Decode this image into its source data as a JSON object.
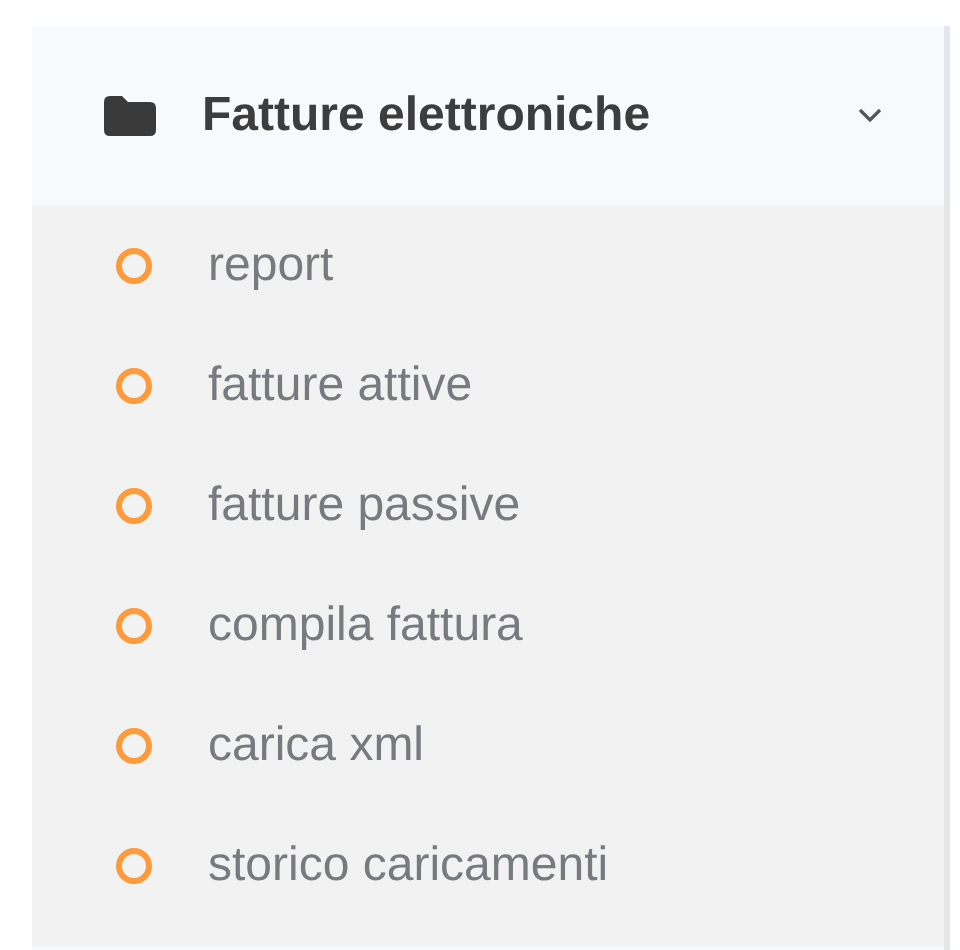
{
  "menu": {
    "title": "Fatture elettroniche",
    "expanded": true,
    "items": [
      {
        "label": "report"
      },
      {
        "label": "fatture attive"
      },
      {
        "label": "fatture passive"
      },
      {
        "label": "compila fattura"
      },
      {
        "label": "carica xml"
      },
      {
        "label": "storico caricamenti"
      }
    ]
  }
}
